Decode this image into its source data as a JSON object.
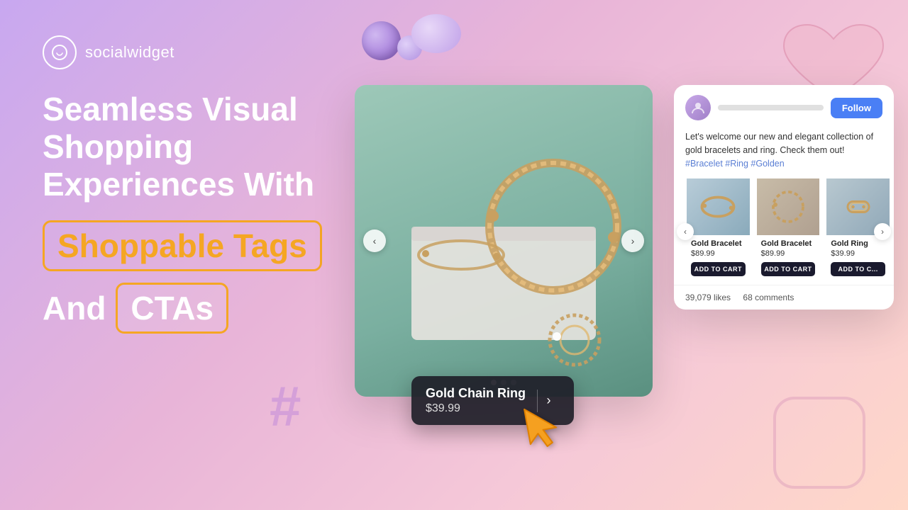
{
  "brand": {
    "logo_text": "socialwidget",
    "logo_icon": "♡"
  },
  "hero": {
    "headline_1": "Seamless Visual",
    "headline_2": "Shopping",
    "headline_3": "Experiences With",
    "highlight_1": "Shoppable Tags",
    "connector": "And",
    "highlight_2": "CTAs"
  },
  "post": {
    "follow_btn": "Follow",
    "caption": "Let's welcome our new and elegant collection of gold bracelets and ring. Check them out!",
    "hashtags": "#Bracelet #Ring #Golden",
    "likes": "39,079 likes",
    "comments": "68 comments"
  },
  "products": [
    {
      "name": "Gold Bracelet",
      "price": "$89.99",
      "btn_label": "ADD TO CART",
      "icon": "◯"
    },
    {
      "name": "Gold Bracelet",
      "price": "$89.99",
      "btn_label": "ADD TO CART",
      "icon": "◯"
    },
    {
      "name": "Gold Ring",
      "price": "$39.99",
      "btn_label": "ADD TO C...",
      "icon": "◇"
    }
  ],
  "product_tag": {
    "name": "Gold Chain Ring",
    "price": "$39.99",
    "arrow": "›"
  },
  "nav": {
    "prev": "‹",
    "next": "›"
  },
  "dots": [
    "active",
    "",
    ""
  ],
  "colors": {
    "accent_orange": "#f5a623",
    "accent_blue": "#4a7ff5",
    "dark_btn": "#1a1a2e"
  }
}
